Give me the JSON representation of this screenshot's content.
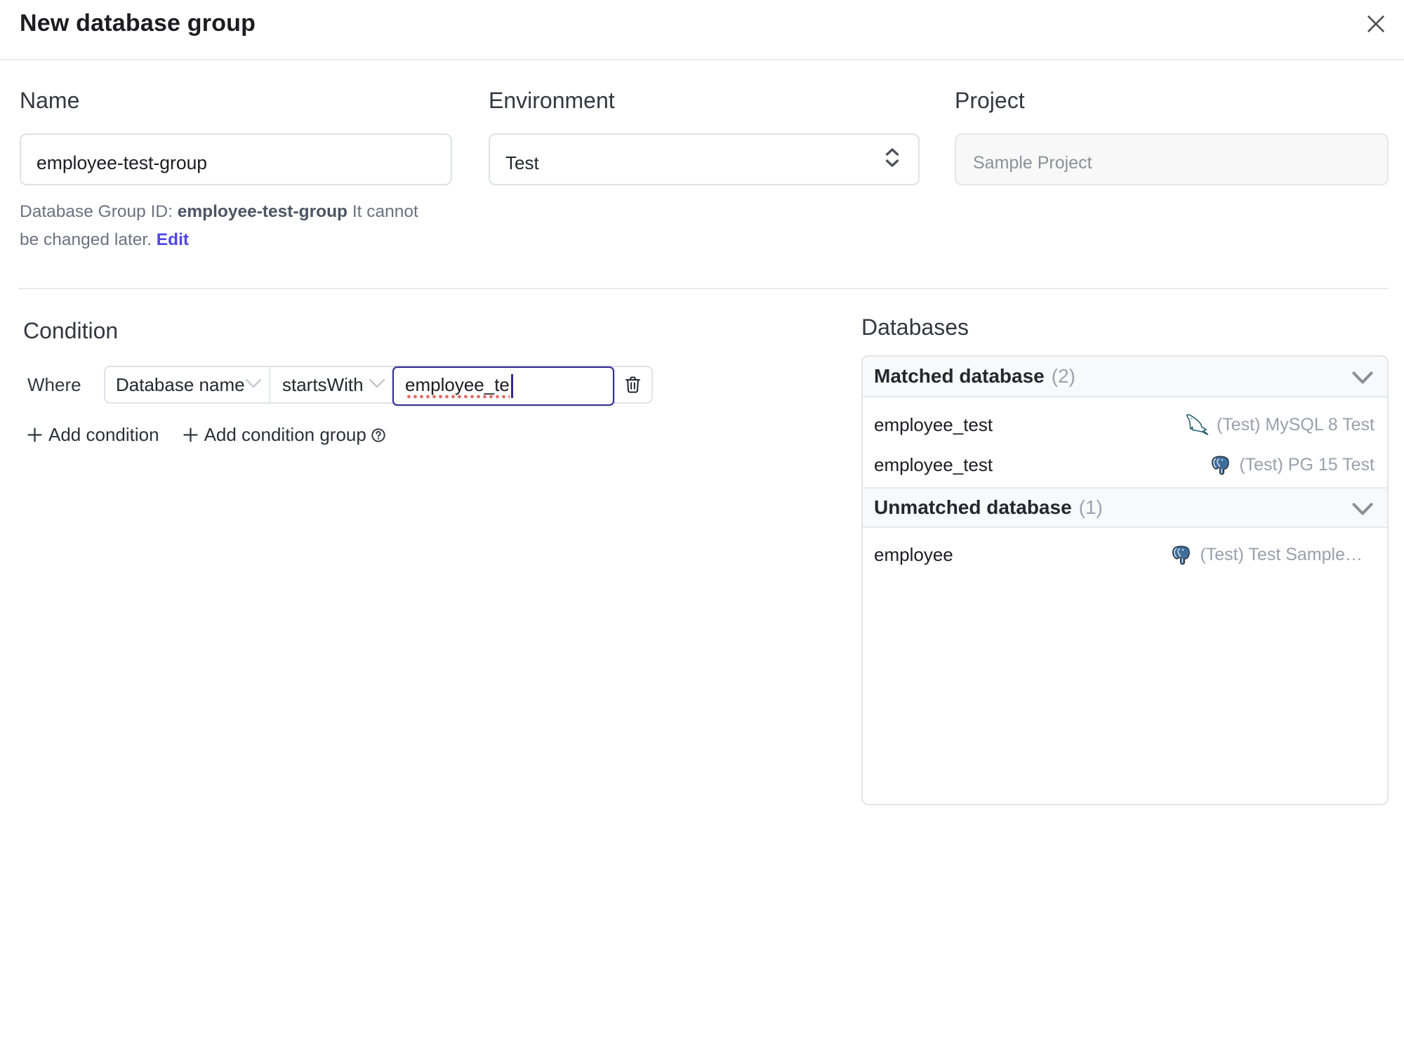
{
  "dialog": {
    "title": "New database group"
  },
  "form": {
    "name": {
      "label": "Name",
      "value": "employee-test-group"
    },
    "environment": {
      "label": "Environment",
      "value": "Test"
    },
    "project": {
      "label": "Project",
      "placeholder": "Sample Project"
    },
    "id_hint": {
      "prefix": "Database Group ID: ",
      "id": "employee-test-group",
      "suffix": " It cannot be changed later. ",
      "edit_label": "Edit"
    }
  },
  "condition": {
    "heading": "Condition",
    "where_label": "Where",
    "factor": "Database name",
    "operator": "startsWith",
    "value": "employee_te",
    "add_condition_label": "Add condition",
    "add_condition_group_label": "Add condition group"
  },
  "databases": {
    "heading": "Databases",
    "matched": {
      "title": "Matched database",
      "count": "(2)",
      "rows": [
        {
          "name": "employee_test",
          "engine": "mysql",
          "instance": "(Test) MySQL 8 Test"
        },
        {
          "name": "employee_test",
          "engine": "postgres",
          "instance": "(Test) PG 15 Test"
        }
      ]
    },
    "unmatched": {
      "title": "Unmatched database",
      "count": "(1)",
      "rows": [
        {
          "name": "employee",
          "engine": "postgres",
          "instance": "(Test) Test Sample…"
        }
      ]
    }
  },
  "colors": {
    "accent": "#4f46e5",
    "focus_border": "#312c8f",
    "spellcheck_dot": "#df685e",
    "divider": "#e6e8eb",
    "muted_text": "#9aa1ab",
    "mysql_icon": "#2a5f71",
    "postgres_icon": "#396b94"
  }
}
